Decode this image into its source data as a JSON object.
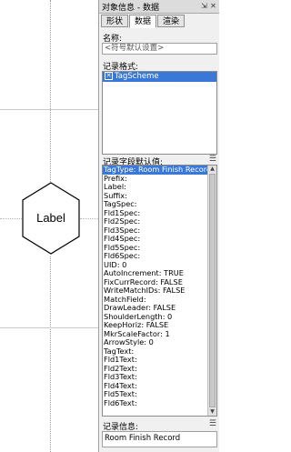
{
  "canvas": {
    "label_text": "Label"
  },
  "palette": {
    "title": "对象信息 - 数据",
    "pin_icon": "pin-icon",
    "close_icon": "close-icon",
    "tabs": [
      {
        "label": "形状",
        "active": false
      },
      {
        "label": "数据",
        "active": true
      },
      {
        "label": "渲染",
        "active": false
      }
    ],
    "name_label": "名称:",
    "name_placeholder": "<符号默认设置>",
    "record_format_label": "记录格式:",
    "record_format_items": [
      {
        "label": "TagScheme",
        "checked": true
      }
    ],
    "record_field_label": "记录字段默认值:",
    "fields": [
      "TagType: Room Finish Record",
      "Prefix:",
      "Label:",
      "Suffix:",
      "TagSpec:",
      "Fld1Spec:",
      "Fld2Spec:",
      "Fld3Spec:",
      "Fld4Spec:",
      "Fld5Spec:",
      "Fld6Spec:",
      "UID: 0",
      "AutoIncrement: TRUE",
      "FixCurrRecord: FALSE",
      "WriteMatchIDs: FALSE",
      "MatchField:",
      "DrawLeader: FALSE",
      "ShoulderLength: 0",
      "KeepHoriz: FALSE",
      "MkrScaleFactor: 1",
      "ArrowStyle: 0",
      "TagText:",
      "Fld1Text:",
      "Fld2Text:",
      "Fld3Text:",
      "Fld4Text:",
      "Fld5Text:",
      "Fld6Text:"
    ],
    "record_info_label": "记录信息:",
    "record_info_value": "Room Finish Record",
    "accent": "#3a78d8"
  }
}
